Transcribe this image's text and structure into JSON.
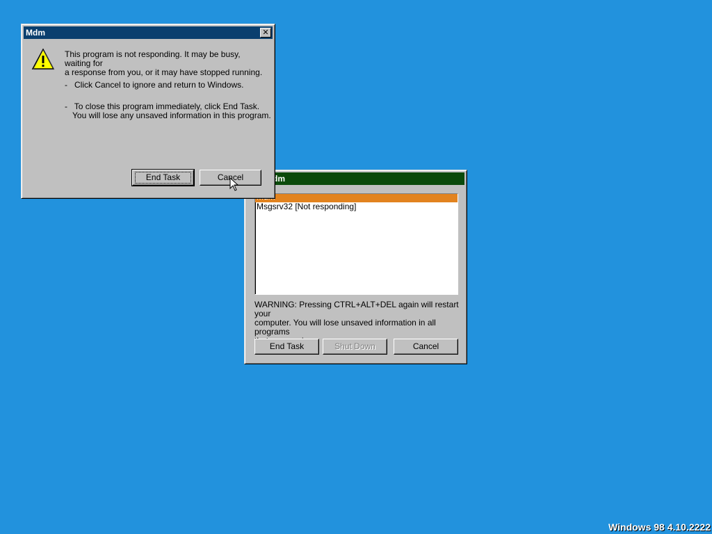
{
  "not_responding_dialog": {
    "title": "Mdm",
    "message_line1": "This program is not responding. It may be busy, waiting for",
    "message_line2": "a response from you, or it may have stopped running.",
    "bullet1": "-   Click Cancel to ignore and return to Windows.",
    "bullet2_line1": "-   To close this program immediately, click End Task.",
    "bullet2_line2": "You will lose any unsaved information in this program.",
    "end_task_label": "End Task",
    "cancel_label": "Cancel",
    "icon": "warning-icon"
  },
  "close_program_dialog": {
    "title": "g ... Mdm",
    "items": [
      {
        "label": "Mdm",
        "selected": true
      },
      {
        "label": "Msgsrv32 [Not responding]",
        "selected": false
      }
    ],
    "warning_line1": "WARNING: Pressing CTRL+ALT+DEL again will restart your",
    "warning_line2": "computer. You will lose unsaved information in all programs",
    "warning_line3": "that are running.",
    "end_task_label": "End Task",
    "shut_down_label": "Shut Down",
    "cancel_label": "Cancel"
  },
  "desktop": {
    "version_text": "Windows 98 4.10.2222",
    "background_color": "#2292dd"
  }
}
